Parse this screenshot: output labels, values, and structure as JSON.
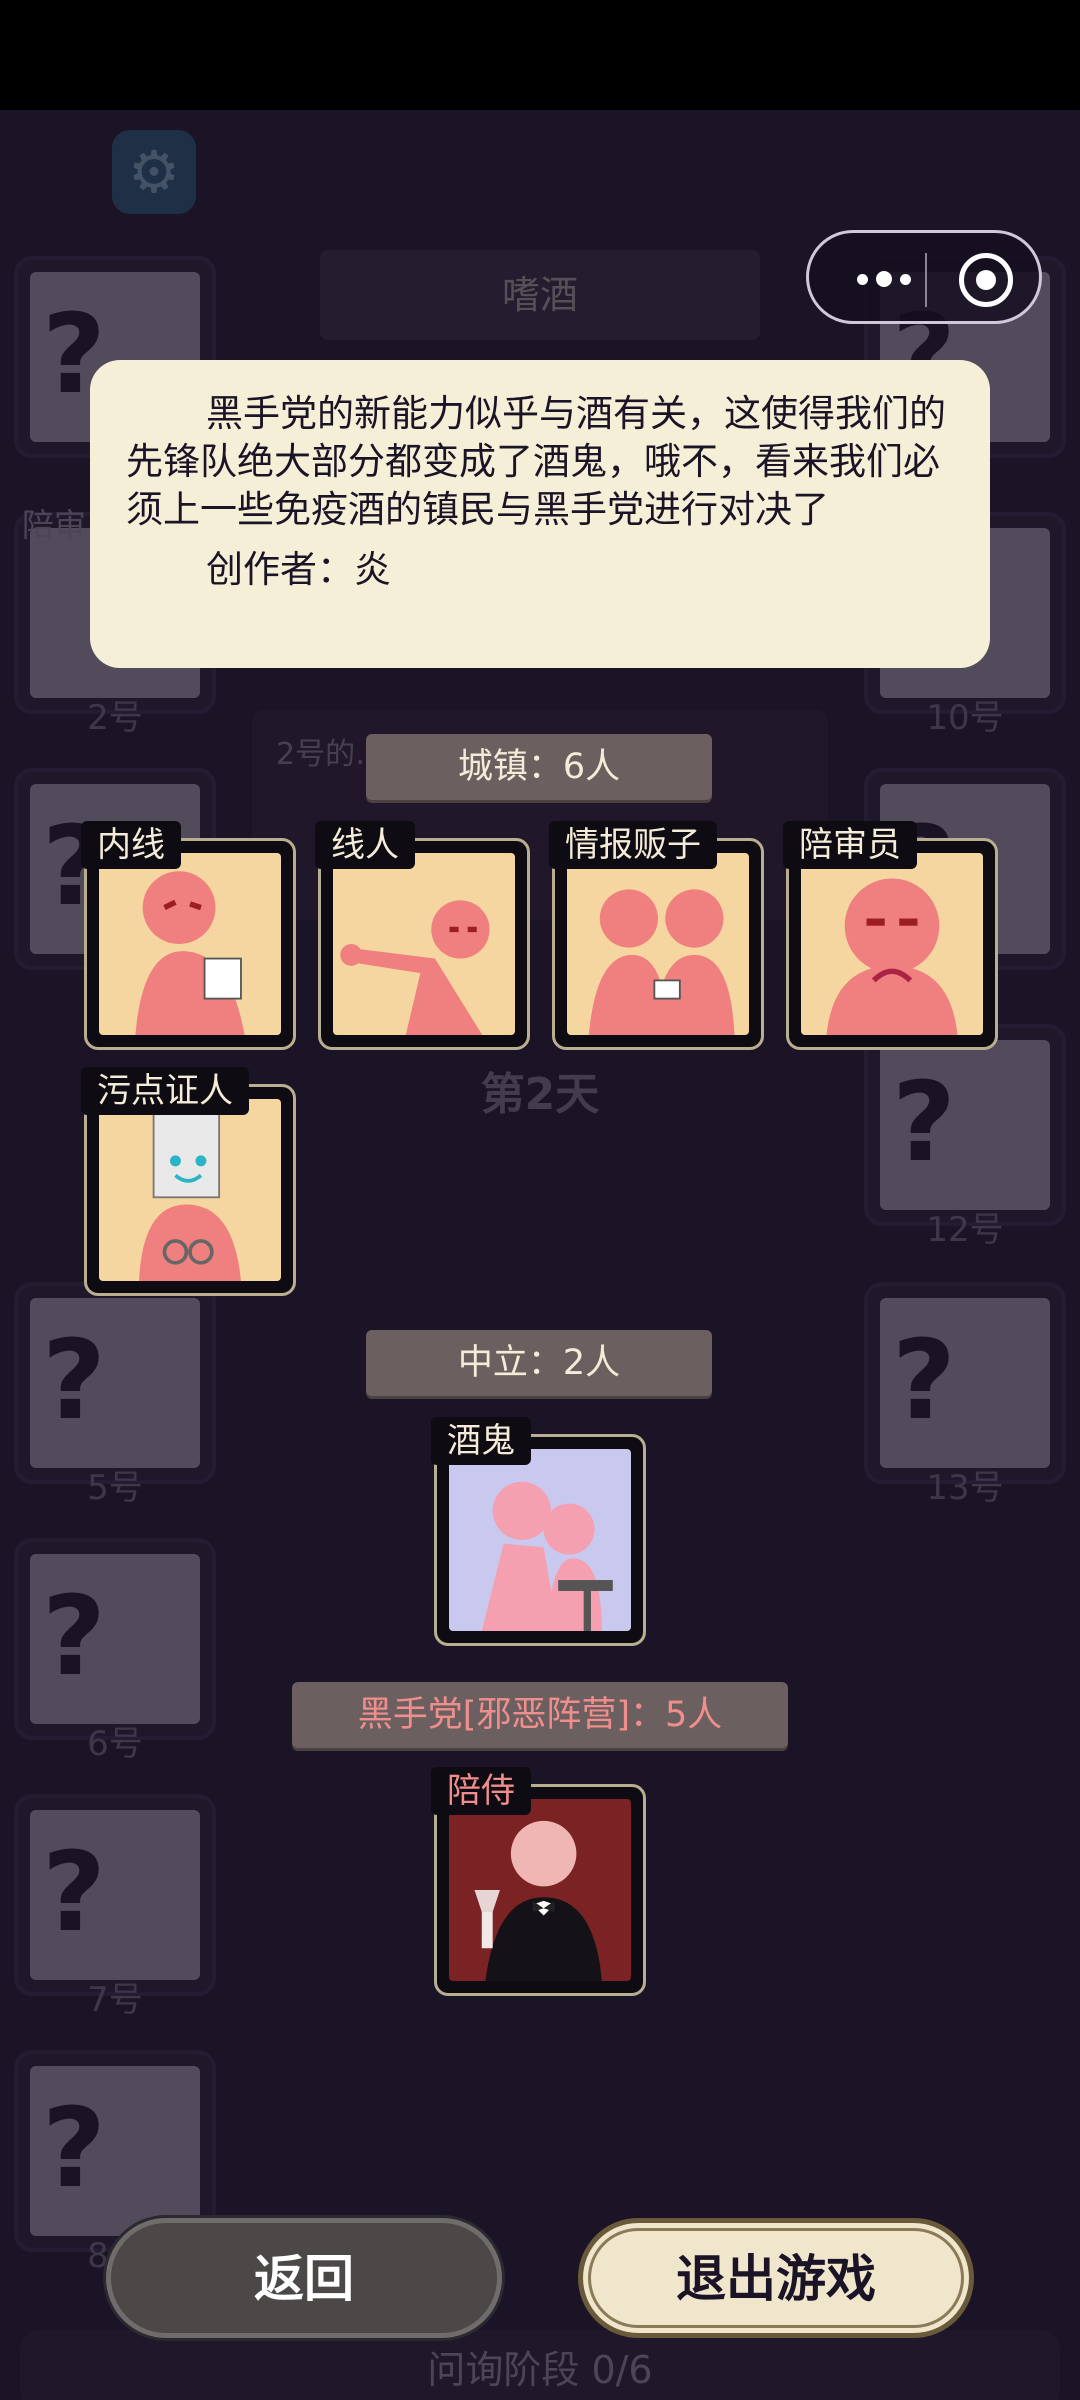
{
  "background": {
    "game_title": "嗜酒",
    "seats_left": [
      "2号",
      "5号",
      "6号",
      "7号",
      "8号"
    ],
    "seats_right": [
      "10号",
      "12号",
      "13号"
    ],
    "partial_label": "陪审",
    "note_text": "2号的… 镇民，… 一",
    "day_label": "第2天",
    "phase_label": "问询阶段 0/6"
  },
  "description": {
    "text": "黑手党的新能力似乎与酒有关，这使得我们的先锋队绝大部分都变成了酒鬼，哦不，看来我们必须上一些免疫酒的镇民与黑手党进行对决了",
    "author": "创作者：炎"
  },
  "sections": {
    "town": {
      "label": "城镇：6人",
      "roles": [
        "内线",
        "线人",
        "情报贩子",
        "陪审员",
        "污点证人"
      ]
    },
    "neutral": {
      "label": "中立：2人",
      "roles": [
        "酒鬼"
      ]
    },
    "mafia": {
      "label": "黑手党[邪恶阵营]：5人",
      "roles": [
        "陪侍"
      ]
    }
  },
  "buttons": {
    "back": "返回",
    "exit": "退出游戏"
  },
  "colors": {
    "background": "#1b1426",
    "panel": "#f6efd7",
    "town_card": "#f5d6a0",
    "neutral_card": "#c9c8ee",
    "evil_card": "#7a2224",
    "evil_text": "#f08e8e"
  }
}
